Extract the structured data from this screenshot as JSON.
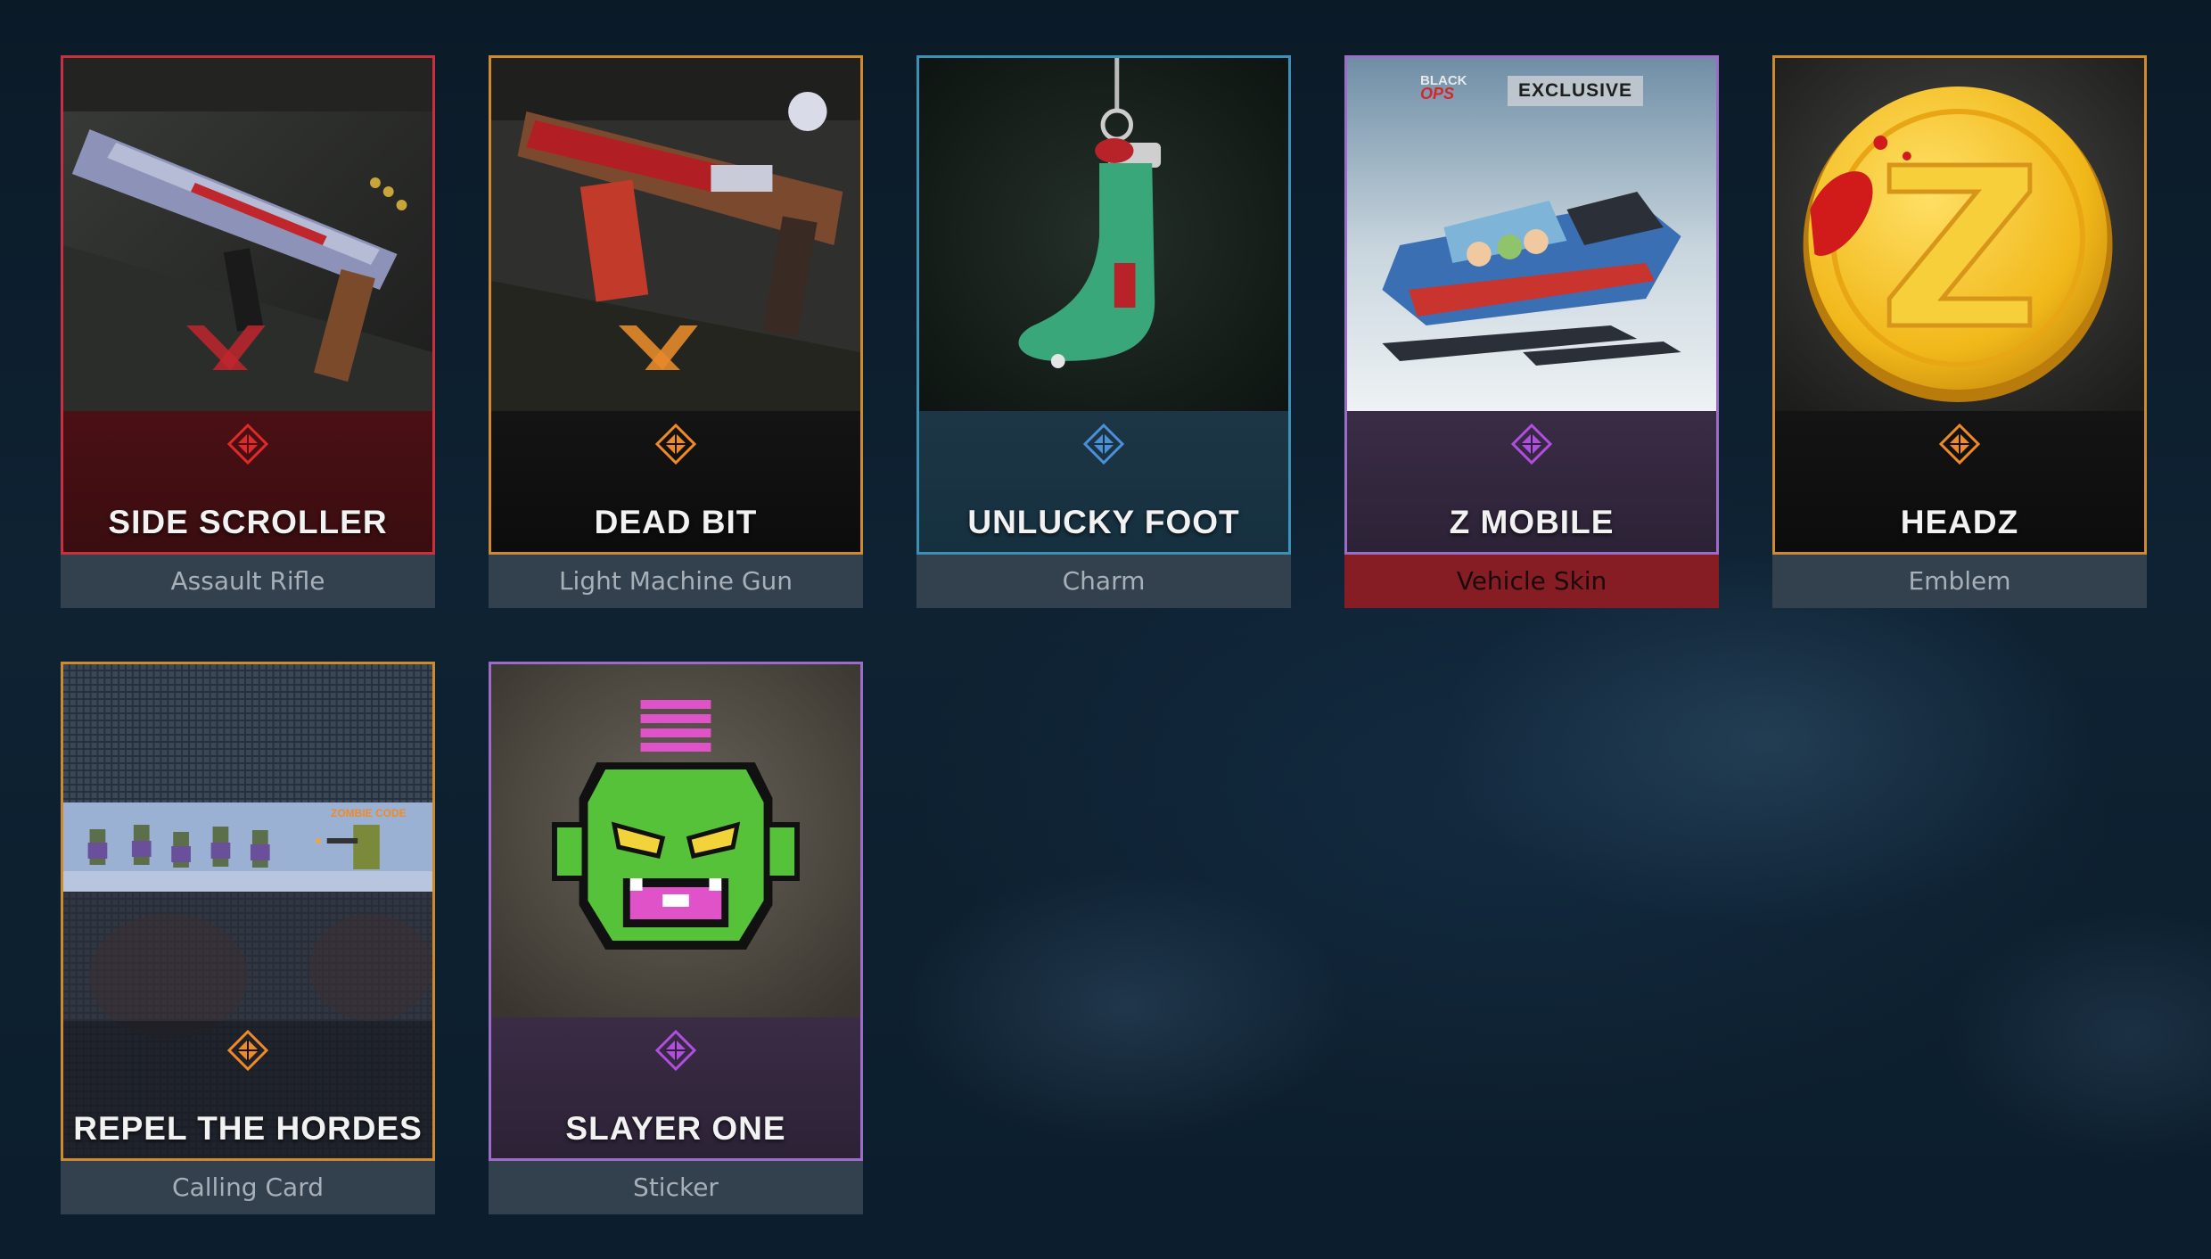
{
  "items": [
    {
      "name": "SIDE SCROLLER",
      "type": "Assault Rifle",
      "rarity": "mythic",
      "accent": "#c8303f"
    },
    {
      "name": "DEAD BIT",
      "type": "Light Machine Gun",
      "rarity": "legendary",
      "accent": "#d08a2e"
    },
    {
      "name": "UNLUCKY FOOT",
      "type": "Charm",
      "rarity": "rare",
      "accent": "#3d8fb8"
    },
    {
      "name": "Z MOBILE",
      "type": "Vehicle Skin",
      "rarity": "epic",
      "accent": "#9b6dc9",
      "badge_brand_top": "BLACK",
      "badge_brand_bottom": "OPS",
      "badge": "EXCLUSIVE"
    },
    {
      "name": "HEADZ",
      "type": "Emblem",
      "rarity": "legendary",
      "accent": "#d08a2e"
    },
    {
      "name": "REPEL THE HORDES",
      "type": "Calling Card",
      "rarity": "legendary",
      "accent": "#d08a2e",
      "banner_text": "ZOMBIE CODE"
    },
    {
      "name": "SLAYER ONE",
      "type": "Sticker",
      "rarity": "epic",
      "accent": "#9b6dc9"
    }
  ],
  "colors": {
    "legendary": "#f08a24",
    "rare": "#4a8fd8",
    "epic": "#b04ee0",
    "mythic": "#e02a2a",
    "exclusive_tag": "#861d24"
  },
  "icons": {
    "rarity": "rarity-diamond-icon"
  }
}
